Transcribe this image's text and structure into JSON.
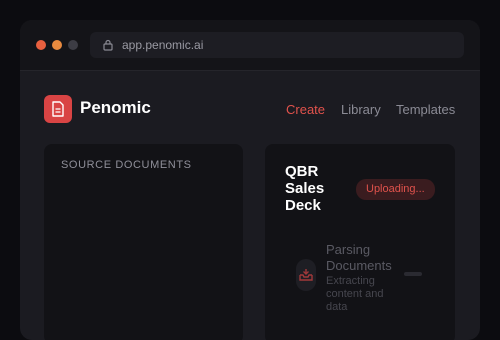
{
  "browser": {
    "url": "app.penomic.ai"
  },
  "brand": {
    "name": "Penomic"
  },
  "nav": {
    "items": [
      "Create",
      "Library",
      "Templates"
    ],
    "active": "Create"
  },
  "source_panel": {
    "title": "SOURCE DOCUMENTS"
  },
  "deck": {
    "title": "QBR Sales Deck",
    "status": "Uploading..."
  },
  "step": {
    "title_line1": "Parsing",
    "title_line2": "Documents",
    "subtitle": "Extracting content and data",
    "icon": "inbox-download-icon"
  },
  "colors": {
    "accent": "#e0524c",
    "badge_bg": "#3a1c1f",
    "logo_bg": "#d94444"
  }
}
